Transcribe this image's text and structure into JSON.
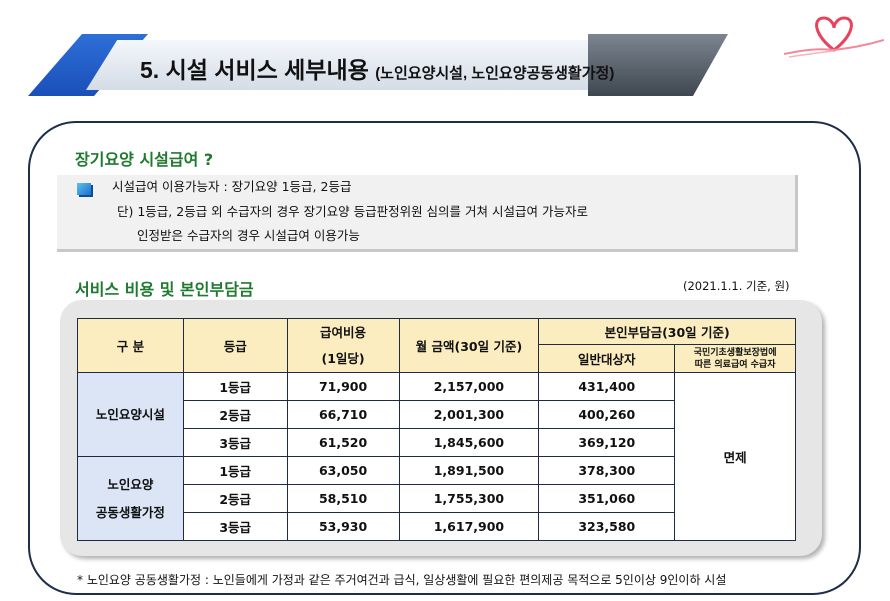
{
  "banner": {
    "title": "5. 시설 서비스 세부내용",
    "subtitle": "(노인요양시설, 노인요양공동생활가정)"
  },
  "section1": {
    "title": "장기요양 시설급여 ?",
    "lines": [
      "시설급여 이용가능자 : 장기요양 1등급, 2등급",
      "단) 1등급, 2등급 외 수급자의 경우 장기요양 등급판정위원 심의를 거쳐 시설급여 가능자로",
      "인정받은 수급자의 경우 시설급여 이용가능"
    ]
  },
  "section2": {
    "title": "서비스 비용 및 본인부담금",
    "basis": "(2021.1.1. 기준, 원)"
  },
  "table": {
    "headers": {
      "category": "구 분",
      "grade": "등급",
      "daily_line1": "급여비용",
      "daily_line2": "(1일당)",
      "monthly": "월 금액(30일 기준)",
      "copay": "본인부담금(30일 기준)",
      "general": "일반대상자",
      "medicaid_line1": "국민기초생활보장법에",
      "medicaid_line2": "따른 의료급여 수급자"
    },
    "group1": "노인요양시설",
    "group2_line1": "노인요양",
    "group2_line2": "공동생활가정",
    "exempt": "면제",
    "rows": [
      {
        "grade": "1등급",
        "daily": "71,900",
        "monthly": "2,157,000",
        "copay": "431,400"
      },
      {
        "grade": "2등급",
        "daily": "66,710",
        "monthly": "2,001,300",
        "copay": "400,260"
      },
      {
        "grade": "3등급",
        "daily": "61,520",
        "monthly": "1,845,600",
        "copay": "369,120"
      },
      {
        "grade": "1등급",
        "daily": "63,050",
        "monthly": "1,891,500",
        "copay": "378,300"
      },
      {
        "grade": "2등급",
        "daily": "58,510",
        "monthly": "1,755,300",
        "copay": "351,060"
      },
      {
        "grade": "3등급",
        "daily": "53,930",
        "monthly": "1,617,900",
        "copay": "323,580"
      }
    ]
  },
  "footnote": "* 노인요양 공동생활가정 : 노인들에게 가정과 같은 주거여건과 급식, 일상생활에 필요한 편의제공 목적으로 5인이상 9인이하 시설",
  "colors": {
    "accent_blue": "#1a4fb8",
    "heading_green": "#1f7a2f",
    "header_fill": "#fbedbf",
    "group_fill": "#dbe5f6",
    "ribbon_pink": "#e8435c"
  }
}
